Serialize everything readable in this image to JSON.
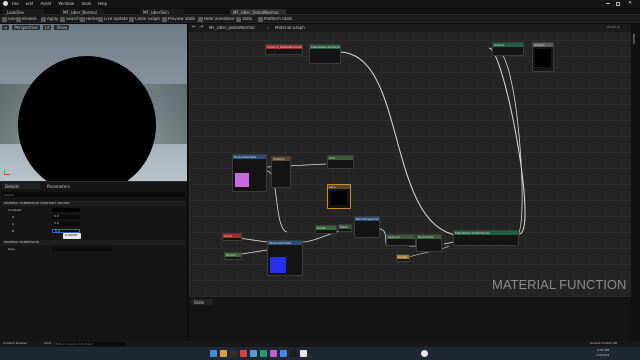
{
  "app": {
    "logo_icon": "unreal-logo-icon",
    "menu": [
      "File",
      "Edit",
      "Asset",
      "Window",
      "Tools",
      "Help"
    ],
    "window_controls": [
      "minimize",
      "maximize",
      "close"
    ]
  },
  "tabs": [
    {
      "label": "_LookDev",
      "active": false
    },
    {
      "label": "MF_Uber_Normal",
      "active": false
    },
    {
      "label": "MF_UberSkin",
      "active": false
    },
    {
      "label": "MF_Uber_DetailNormal",
      "active": true
    }
  ],
  "toolbar": {
    "items": [
      "Save",
      "Browse",
      "Apply",
      "Search",
      "Home",
      "Live Update",
      "Clean Graph",
      "Preview State",
      "Hide Unrelated",
      "Stats",
      "Platform Stats"
    ]
  },
  "viewport": {
    "chips": [
      "Perspective",
      "Lit",
      "Show"
    ]
  },
  "details": {
    "tabs": [
      "Details",
      "Parameters"
    ],
    "search_placeholder": "Search",
    "sections": [
      {
        "label": "MATERIAL EXPRESSION CONSTANT VECTOR",
        "rows": [
          {
            "label": "Constant",
            "value": ""
          },
          {
            "label": "R",
            "value": "0.0"
          },
          {
            "label": "G",
            "value": "0.0"
          },
          {
            "label": "B",
            "value": "0.0"
          }
        ]
      },
      {
        "label": "MATERIAL EXPRESSION",
        "rows": [
          {
            "label": "Desc",
            "value": ""
          }
        ]
      }
    ],
    "tooltip": "0.00000"
  },
  "graph": {
    "breadcrumb_root": "MF_Uber_DetailNormal",
    "breadcrumb_leaf": "Material Graph",
    "zoom": "Zoom -4",
    "nodes": [
      {
        "title": "Input In_DetailNormalSwitch",
        "color": "#a52a2a"
      },
      {
        "title": "MakeMaterialAttributes",
        "color": "#1f5f3f"
      },
      {
        "title": "Output",
        "color": "#5a5a5a"
      },
      {
        "title": "TextureSample",
        "color": "#2d4e7a"
      },
      {
        "title": "Multiply",
        "color": "#3a5a3a"
      },
      {
        "title": "Add",
        "color": "#3a5a3a"
      },
      {
        "title": "Lerp",
        "color": "#5a4a2a"
      },
      {
        "title": "Input",
        "color": "#a52a2a"
      },
      {
        "title": "Param",
        "color": "#3a6a3a"
      },
      {
        "title": "TextureSample",
        "color": "#2d4e7a"
      },
      {
        "title": "BlendAngleCorrectedNormals",
        "color": "#2d4e7a"
      },
      {
        "title": "Append",
        "color": "#3a5a3a"
      },
      {
        "title": "Normalize",
        "color": "#3a5a3a"
      },
      {
        "title": "Const",
        "color": "#3a6a3a"
      },
      {
        "title": "Mask",
        "color": "#3a5a3a"
      }
    ],
    "watermark": "MATERIAL FUNCTION"
  },
  "stats": {
    "tab": "Stats"
  },
  "statusbar": {
    "content_drawer": "Content Drawer",
    "cmd": "Cmd",
    "console_placeholder": "Enter Console Command",
    "source_control": "Source Control Off"
  },
  "taskbar": {
    "time": "4:56 PM",
    "date": "1/4/2024",
    "icon_colors": [
      "#3b8ee0",
      "#e0a030",
      "#2f2f2f",
      "#d9413b",
      "#5b9bd5",
      "#22a06b",
      "#c65dd6",
      "#4a86e8",
      "#1c1c1c",
      "#e8e8e8",
      "#3a3a3a"
    ]
  }
}
